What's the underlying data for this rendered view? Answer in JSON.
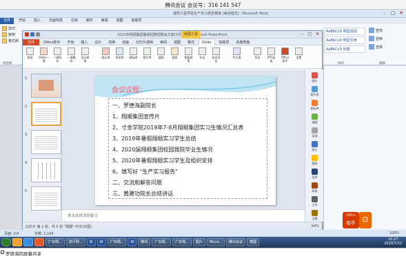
{
  "meeting": {
    "title": "腾讯会议 会议号：316 141 547"
  },
  "word": {
    "title": "建筑工程学院生产实习报告模板 [兼容模式] - Microsoft Word",
    "tabs": [
      "文件",
      "开始",
      "插入",
      "页面布局",
      "引用",
      "邮件",
      "审阅",
      "视图",
      "加载项"
    ],
    "left_buttons": [
      "剪切",
      "复制",
      "格式刷"
    ],
    "styles": [
      "AaBbCcD",
      "AaBbCcD",
      "AaBbCcD"
    ],
    "style_names": [
      "明显强调",
      "明显引用",
      "标题"
    ],
    "edit_buttons": [
      "查找",
      "替换",
      "选择"
    ],
    "groups": [
      "剪贴板",
      "样式",
      "编辑"
    ],
    "status": {
      "page": "页面: 2/4",
      "words": "字数: 1,104",
      "zoom": "100%"
    }
  },
  "ppt": {
    "title": "2020年翔顺集团暑假招聘招聘会方案(5月8日) - Microsoft PowerPoint",
    "context_tab": "绘图工具",
    "tabs": [
      "文件",
      "Office助手",
      "开始",
      "插入",
      "设计",
      "切换",
      "动画",
      "幻灯片放映",
      "审阅",
      "视图",
      "格式",
      "iSlide",
      "加载项",
      "百度网盘"
    ],
    "ribbon": [
      "登录",
      "iSlide一键",
      "一键优化",
      "一键美化",
      "设计排版",
      "图示库",
      "色彩库",
      "图标库",
      "图片库",
      "插图",
      "图表",
      "智能图表",
      "补全",
      "安全导出",
      "AI工具",
      "导出",
      "PPT画板",
      "Office助手",
      "设置"
    ],
    "groups": [
      "帐户",
      "设计",
      "资源",
      "插入素材",
      "AI工具",
      "工具"
    ],
    "right_pane": [
      "图片",
      "图片库",
      "图标库",
      "插图",
      "资源",
      "图示",
      "图表",
      "形状",
      "帮助",
      "工作",
      "主题"
    ],
    "thumbs": [
      "1",
      "2",
      "3",
      "4",
      "5"
    ],
    "slide": {
      "title": "会议议程：",
      "items": [
        "一、罗德海副院长",
        "1、翔顺集团宣传片",
        "2、寸金学院2019年7-8月翔顺集团实习生情况汇总表",
        "3、2019年暑假翔顺实习学生总结",
        "4、2020届翔顺集团校园我院毕业生情况",
        "5、2020年暑假翔顺实习学生及组织安排",
        "6、填写好 \"生产实习报告\"",
        "二、交流和解答问题",
        "三、黄建功院长总结讲话"
      ]
    },
    "notes": "单击此处添加备注",
    "status": {
      "left": "幻灯片 第 2 张，共 5 张   \"翔顺\"   中文(中国)",
      "zoom": "64%"
    }
  },
  "taskbar": [
    "开始",
    "",
    "",
    "",
    "广东翔...",
    "流汗网...",
    "W",
    "W",
    "广东翔...",
    "W",
    "腾讯",
    "广东翔...",
    "广东翔...",
    "图片",
    "Micro...",
    "腾讯会议",
    "截图"
  ],
  "clock": {
    "time": "10:27",
    "date": "2020/7/13"
  },
  "share": {
    "text": "罗德海的屏幕共享"
  },
  "office_ad": {
    "line1": "Office",
    "line2": "助手"
  }
}
